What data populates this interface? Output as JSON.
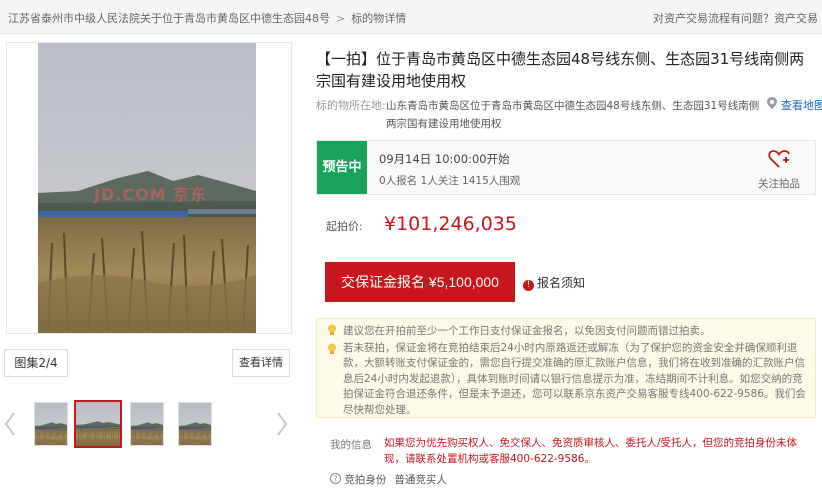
{
  "breadcrumb": {
    "court": "江苏省泰州市中级人民法院关于位于青岛市黄岛区中德生态园48号",
    "current": "标的物详情"
  },
  "help_link": "对资产交易流程有问题？资产交易",
  "gallery": {
    "watermark": "JD.COM 京东",
    "album_label": "图集2/4",
    "detail_button": "查看详情",
    "prev_icon": "chevron-left-icon",
    "next_icon": "chevron-right-icon"
  },
  "item": {
    "title": "【一拍】位于青岛市黄岛区中德生态园48号线东侧、生态园31号线南侧两宗国有建设用地使用权",
    "location_label": "标的物所在地:",
    "location": "山东青岛市黄岛区位于青岛市黄岛区中德生态园48号线东侧、生态园31号线南侧两宗国有建设用地使用权",
    "map_link": "查看地图"
  },
  "status": {
    "badge": "预告中",
    "start_time": "09月14日 10:00:00开始",
    "stats": "0人报名 1人关注 1415人围观",
    "follow_label": "关注拍品"
  },
  "pricing": {
    "label": "起拍价:",
    "value": "¥101,246,035"
  },
  "actions": {
    "deposit_button": "交保证金报名 ¥5,100,000",
    "notice": "报名须知",
    "notice_mark": "!"
  },
  "tips": {
    "tip1": "建议您在开拍前至少一个工作日支付保证金报名，以免因支付问题而错过拍卖。",
    "tip2": "若未获拍，保证金将在竞拍结束后24小时内原路返还或解冻（为了保护您的资金安全并确保顺利退款，大额转账支付保证金的，需您自行提交准确的原汇款账户信息，我们将在收到准确的汇款账户信息后24小时内发起退款），具体到账时间请以银行信息提示为准，冻结期间不计利息。如您交纳的竞拍保证金符合退还条件，但是未予退还，您可以联系京东资产交易客服专线400-622-9586。我们会尽快帮您处理。"
  },
  "my_info": {
    "label": "我的信息",
    "text": "如果您为优先购买权人、免交保人、免资质审核人、委托人/受托人，但您的竞拍身份未体现，请联系处置机构或客服400-622-9586。",
    "bid_identity_label": "竞拍身份",
    "bid_identity_value": "普通竞买人"
  },
  "colors": {
    "accent_red": "#c8161d",
    "status_green": "#1aa25a",
    "link_blue": "#2266bb",
    "tip_bg": "#fdfbe7"
  }
}
